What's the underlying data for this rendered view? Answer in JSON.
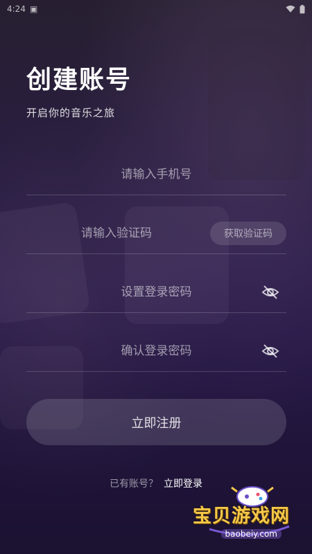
{
  "status_bar": {
    "time": "4:24"
  },
  "header": {
    "title": "创建账号",
    "subtitle": "开启你的音乐之旅"
  },
  "form": {
    "phone": {
      "placeholder": "请输入手机号",
      "value": ""
    },
    "code": {
      "placeholder": "请输入验证码",
      "value": "",
      "send_label": "获取验证码"
    },
    "password": {
      "placeholder": "设置登录密码",
      "value": ""
    },
    "confirm": {
      "placeholder": "确认登录密码",
      "value": ""
    },
    "submit_label": "立即注册"
  },
  "footer": {
    "question": "已有账号？",
    "login_link": "立即登录"
  },
  "watermark": {
    "name": "宝贝游戏网",
    "url": "baobeiy.com"
  },
  "icons": {
    "eye_hidden": "eye-off-icon",
    "wifi": "wifi-icon",
    "battery": "battery-icon"
  },
  "colors": {
    "accent": "#f6c84a",
    "background": "#2a1b4d"
  }
}
